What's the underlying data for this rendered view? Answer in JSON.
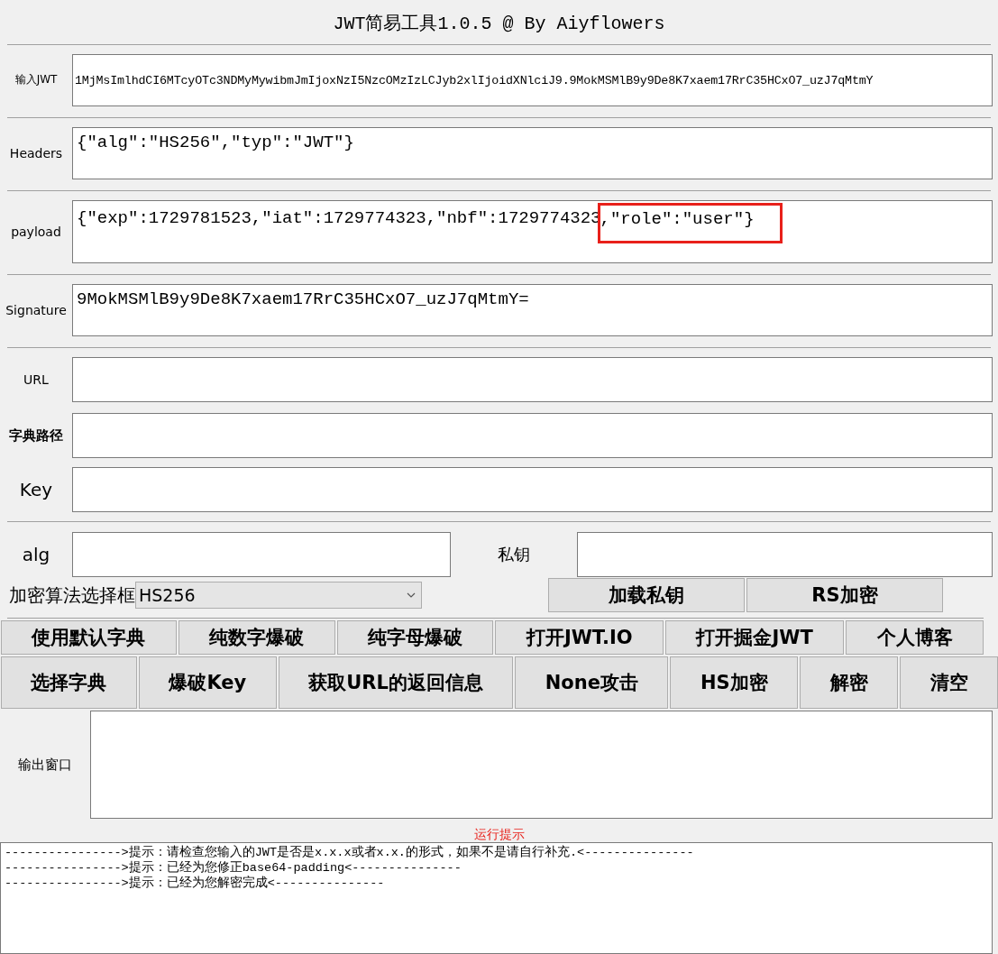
{
  "window": {
    "title": "JWT简易工具1.0.5 @ By Aiyflowers"
  },
  "fields": [
    {
      "label": "输入JWT",
      "kind": "token",
      "value": "1MjMsImlhdCI6MTcyOTc3NDMyMywibmJmIjoxNzI5NzcOMzIzLCJyb2xlIjoidXNlciJ9.9MokMSMlB9y9De8K7xaem17RrC35HCxO7_uzJ7qMtmY"
    },
    {
      "label": "Headers",
      "kind": "json",
      "value": "{\"alg\":\"HS256\",\"typ\":\"JWT\"}"
    },
    {
      "label": "payload",
      "kind": "json",
      "value": "{\"exp\":1729781523,\"iat\":1729774323,\"nbf\":1729774323",
      "highlighted": ",\"role\":\"user\"}"
    },
    {
      "label": "Signature",
      "kind": "json",
      "value": "9MokMSMlB9y9De8K7xaem17RrC35HCxO7_uzJ7qMtmY="
    },
    {
      "label": "URL",
      "kind": "json"
    },
    {
      "label": "字典路径",
      "kind": "bold"
    },
    {
      "label": "Key",
      "kind": "large"
    }
  ],
  "alg": {
    "label": "alg",
    "private_key_label": "私钥"
  },
  "algorithm_select": {
    "label": "加密算法选择框",
    "value": "HS256"
  },
  "key_buttons": [
    "加载私钥",
    "RS加密"
  ],
  "button_rows": [
    [
      "使用默认字典",
      "纯数字爆破",
      "纯字母爆破",
      "打开JWT.IO",
      "打开掘金JWT",
      "个人博客"
    ],
    [
      "选择字典",
      "爆破Key",
      "获取URL的返回信息",
      "None攻击",
      "HS加密",
      "解密",
      "清空"
    ]
  ],
  "output": {
    "label": "输出窗口"
  },
  "log": {
    "title": "运行提示",
    "lines": [
      "---------------->提示：请检查您输入的JWT是否是x.x.x或者x.x.的形式，如果不是请自行补充.<---------------",
      "---------------->提示：已经为您修正base64-padding<---------------",
      "---------------->提示：已经为您解密完成<---------------"
    ]
  }
}
